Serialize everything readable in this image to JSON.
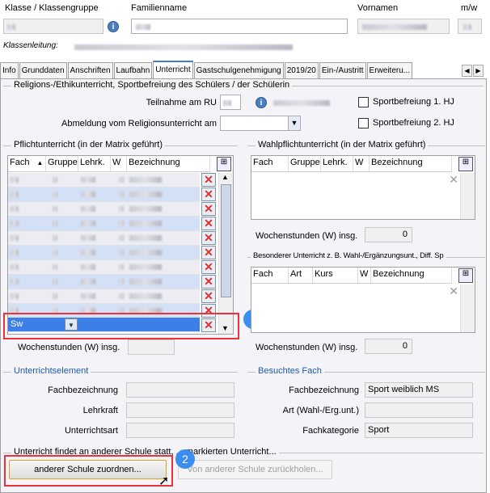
{
  "header": {
    "klasse_label": "Klasse / Klassengruppe",
    "familienname_label": "Familienname",
    "vornamen_label": "Vornamen",
    "mw_label": "m/w",
    "klassenleitung_label": "Klassenleitung:"
  },
  "tabs": [
    {
      "label": "Info"
    },
    {
      "label": "Grunddaten"
    },
    {
      "label": "Anschriften"
    },
    {
      "label": "Laufbahn"
    },
    {
      "label": "Unterricht",
      "active": true
    },
    {
      "label": "Gastschulgenehmigung"
    },
    {
      "label": "2019/20"
    },
    {
      "label": "Ein-/Austritt"
    },
    {
      "label": "Erweiteru..."
    }
  ],
  "religion": {
    "title": "Religions-/Ethikunterricht, Sportbefreiung des Schülers / der Schülerin",
    "teilnahme_label": "Teilnahme am RU",
    "abmeldung_label": "Abmeldung vom Religionsunterricht am",
    "sport1_label": "Sportbefreiung 1. HJ",
    "sport2_label": "Sportbefreiung 2. HJ"
  },
  "pflicht": {
    "title": "Pflichtunterricht (in der Matrix geführt)",
    "columns": [
      "Fach",
      "Gruppe",
      "Lehrk.",
      "W",
      "Bezeichnung"
    ],
    "selected_row_fach": "Sw",
    "wochenstunden_label": "Wochenstunden (W) insg."
  },
  "wahlpflicht": {
    "title": "Wahlpflichtunterricht (in der Matrix geführt)",
    "columns": [
      "Fach",
      "Gruppe",
      "Lehrk.",
      "W",
      "Bezeichnung"
    ],
    "wochenstunden_label": "Wochenstunden (W) insg.",
    "wochenstunden_value": "0"
  },
  "besonderer": {
    "title": "Besonderer Unterricht z. B. Wahl-/Ergänzungsunt., Diff. Sp",
    "columns": [
      "Fach",
      "Art",
      "Kurs",
      "W",
      "Bezeichnung"
    ],
    "wochenstunden_label": "Wochenstunden (W) insg.",
    "wochenstunden_value": "0"
  },
  "unterrichtselement": {
    "title": "Unterrichtselement",
    "fachbezeichnung_label": "Fachbezeichnung",
    "lehrkraft_label": "Lehrkraft",
    "unterrichtsart_label": "Unterrichtsart"
  },
  "besuchtes_fach": {
    "title": "Besuchtes Fach",
    "fachbezeichnung_label": "Fachbezeichnung",
    "fachbezeichnung_value": "Sport weiblich MS",
    "art_label": "Art (Wahl-/Erg.unt.)",
    "fachkategorie_label": "Fachkategorie",
    "fachkategorie_value": "Sport"
  },
  "andere_schule": {
    "title": "Unterricht findet an anderer Schule statt, ... markierten Unterricht...",
    "zuordnen_label": "anderer Schule zuordnen...",
    "zurueckholen_label": "Von anderer Schule zurückholen..."
  },
  "annotations": {
    "badge1": "1",
    "badge2": "2"
  },
  "colors": {
    "accent": "#3b8ef0",
    "highlight": "#e8323c",
    "selection": "#3c7fe6"
  }
}
